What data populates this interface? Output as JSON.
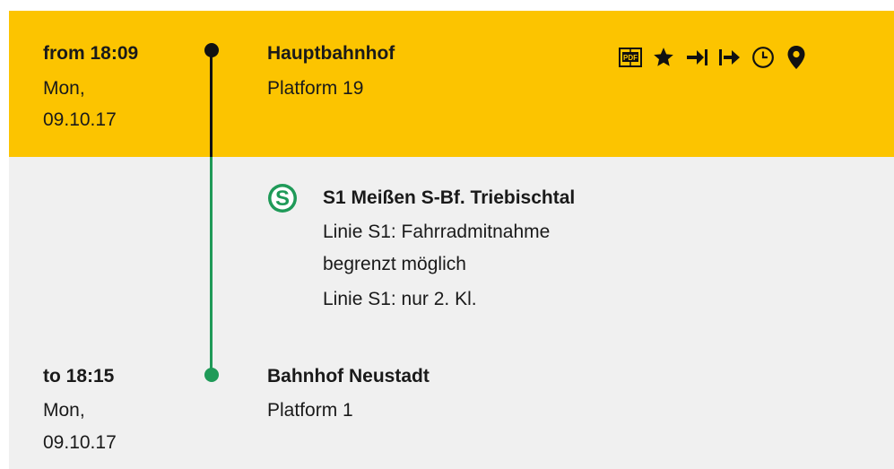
{
  "departure": {
    "time": "from 18:09",
    "day": "Mon,",
    "date": "09.10.17",
    "station": "Hauptbahnhof",
    "platform": "Platform 19"
  },
  "toolbar": {
    "icons": [
      "pdf-icon",
      "star-icon",
      "arrow-to-bar-icon",
      "arrow-from-bar-icon",
      "clock-icon",
      "location-pin-icon"
    ]
  },
  "train": {
    "badge": "S",
    "title": "S1 Meißen S-Bf. Triebischtal",
    "notes": [
      "Linie S1: Fahrradmitnahme",
      "begrenzt möglich",
      "Linie S1: nur 2. Kl."
    ]
  },
  "arrival": {
    "time": "to 18:15",
    "day": "Mon,",
    "date": "09.10.17",
    "station": "Bahnhof Neustadt",
    "platform": "Platform 1"
  },
  "colors": {
    "header_bg": "#fcc400",
    "body_bg": "#f0f0f0",
    "line_green": "#1f9a58",
    "line_black": "#111111"
  }
}
